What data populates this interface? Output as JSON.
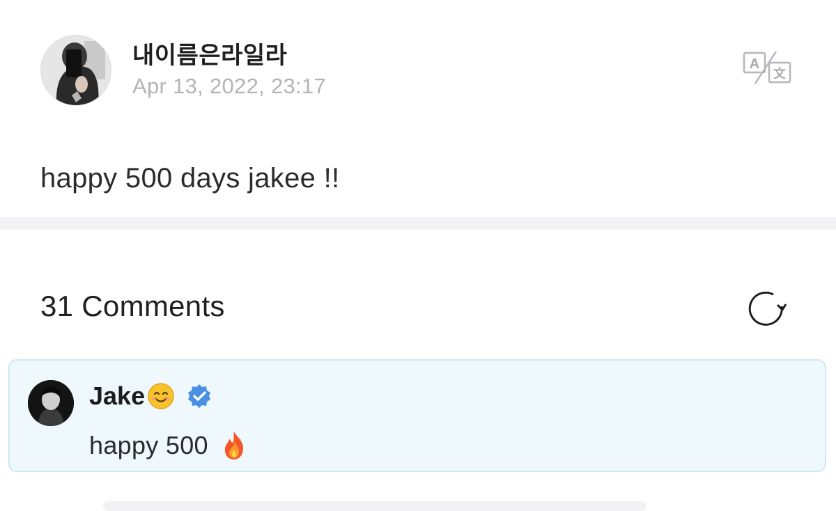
{
  "post": {
    "author": "내이름은라일라",
    "timestamp": "Apr 13, 2022, 23:17",
    "body": "happy 500 days jakee !!",
    "icons": {
      "avatar": "profile-photo",
      "translate": "translate-icon"
    }
  },
  "comments": {
    "header": "31 Comments",
    "refresh_icon": "refresh-icon",
    "items": [
      {
        "author": "Jake",
        "author_emoji": "smiling-face-icon",
        "verified": true,
        "text": "happy 500",
        "text_emoji": "fire-icon"
      }
    ]
  },
  "colors": {
    "highlight_bg": "#eef8fd",
    "highlight_border": "#cfe7f2",
    "verified_blue": "#4a90e2",
    "timestamp_gray": "#b3b3b8",
    "divider": "#f3f3f6"
  }
}
